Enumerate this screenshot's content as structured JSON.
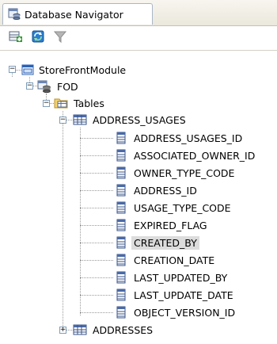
{
  "tab": {
    "label": "Database Navigator",
    "icon": "database-navigator-icon"
  },
  "toolbar": {
    "buttons": [
      {
        "name": "new-connection-icon"
      },
      {
        "name": "refresh-icon"
      },
      {
        "name": "filter-icon"
      }
    ]
  },
  "tree": {
    "module": "StoreFrontModule",
    "connection": "FOD",
    "tables_folder": "Tables",
    "table": "ADDRESS_USAGES",
    "columns": [
      "ADDRESS_USAGES_ID",
      "ASSOCIATED_OWNER_ID",
      "OWNER_TYPE_CODE",
      "ADDRESS_ID",
      "USAGE_TYPE_CODE",
      "EXPIRED_FLAG",
      "CREATED_BY",
      "CREATION_DATE",
      "LAST_UPDATED_BY",
      "LAST_UPDATE_DATE",
      "OBJECT_VERSION_ID"
    ],
    "selected_column": "CREATED_BY",
    "next_table": "ADDRESSES"
  }
}
